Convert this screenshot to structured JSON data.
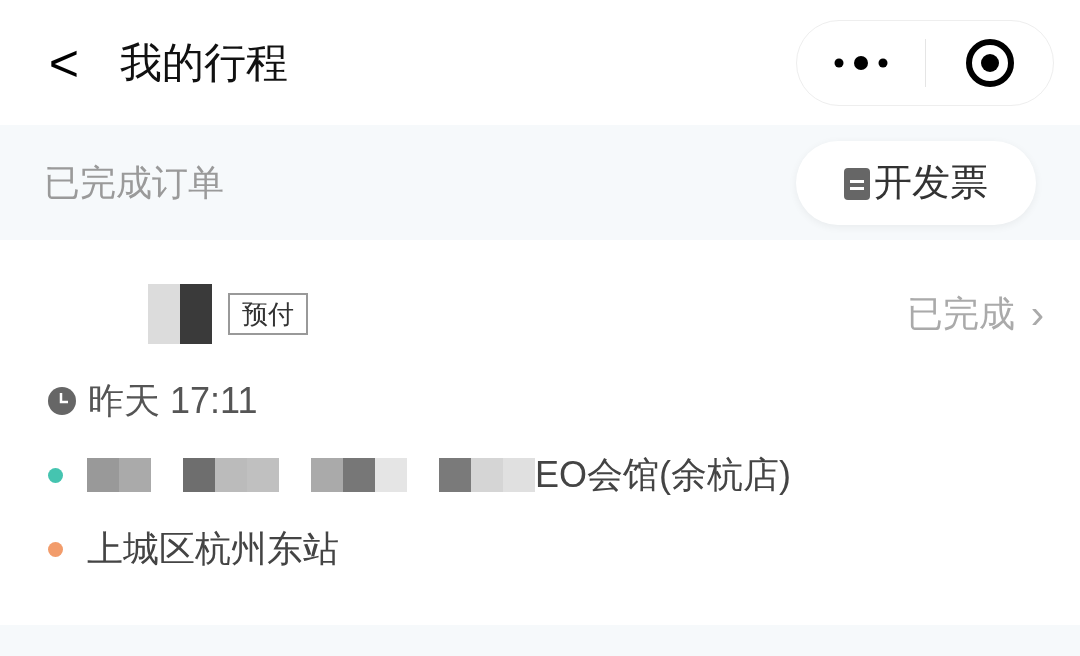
{
  "header": {
    "back": "<",
    "title": "我的行程"
  },
  "section": {
    "title": "已完成订单",
    "invoice_button": "开发票"
  },
  "order": {
    "redacted_name": true,
    "badge": "预付",
    "status": "已完成",
    "status_arrow": "›",
    "time": "昨天 17:11",
    "stops": [
      {
        "text": "EO会馆(余杭店)",
        "color": "#45c4b0",
        "redacted": true
      },
      {
        "text": "上城区杭州东站",
        "color": "#f29c6b",
        "redacted": false
      }
    ]
  }
}
